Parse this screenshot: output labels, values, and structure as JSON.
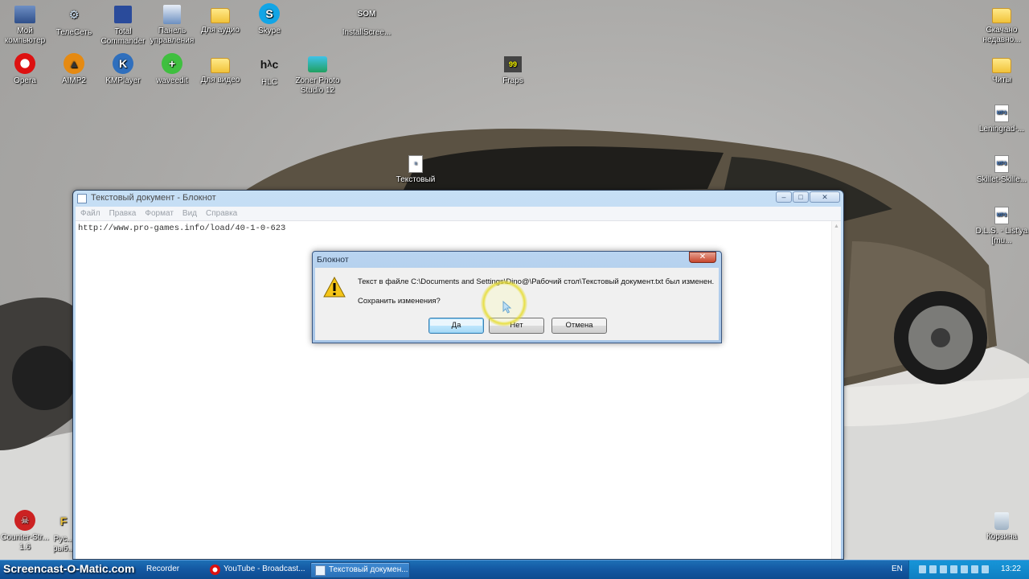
{
  "desktop": {
    "icons": [
      {
        "label": "Мой компьютер",
        "icon": "computer-icon"
      },
      {
        "label": "ТелеСеть",
        "icon": "network-icon"
      },
      {
        "label": "Total Commander",
        "icon": "floppy-icon"
      },
      {
        "label": "Панель управления",
        "icon": "control-panel-icon"
      },
      {
        "label": "Для аудио",
        "icon": "folder-icon"
      },
      {
        "label": "Skype",
        "icon": "skype-icon"
      },
      {
        "label": "InstallScree...",
        "icon": "som-icon"
      },
      {
        "label": "Скачано недавно...",
        "icon": "folder-icon"
      },
      {
        "label": "Opera",
        "icon": "opera-icon"
      },
      {
        "label": "AIMP2",
        "icon": "aimp-icon"
      },
      {
        "label": "KMPlayer",
        "icon": "kmplayer-icon"
      },
      {
        "label": "waveedit",
        "icon": "waveedit-icon"
      },
      {
        "label": "Для видео",
        "icon": "folder-icon"
      },
      {
        "label": "HLC",
        "icon": "hlc-icon"
      },
      {
        "label": "Zoner Photo Studio 12",
        "icon": "zoner-icon"
      },
      {
        "label": "Fraps",
        "icon": "fraps-icon"
      },
      {
        "label": "Читы",
        "icon": "folder-icon"
      },
      {
        "label": "Leningrad-...",
        "icon": "mp3-file-icon"
      },
      {
        "label": "Skillet-Skille...",
        "icon": "mp3-file-icon"
      },
      {
        "label": "D.L.S. - List'ya [mu...",
        "icon": "mp3-file-icon"
      },
      {
        "label": "Текстовый",
        "icon": "text-file-icon"
      },
      {
        "label": "Counter-Str... 1.6",
        "icon": "counter-strike-icon"
      },
      {
        "label": "Рус... рыб...",
        "icon": "game-icon"
      },
      {
        "label": "Корзина",
        "icon": "recycle-bin-icon"
      }
    ]
  },
  "notepad": {
    "title": "Текстовый документ - Блокнот",
    "menu": [
      "Файл",
      "Правка",
      "Формат",
      "Вид",
      "Справка"
    ],
    "content": "http://www.pro-games.info/load/40-1-0-623",
    "controls": {
      "minimize": "–",
      "maximize": "□",
      "close": "✕"
    }
  },
  "dialog": {
    "title": "Блокнот",
    "close": "✕",
    "message": "Текст в файле C:\\Documents and Settings\\Dino@\\Рабочий стол\\Текстовый документ.txt был изменен.",
    "question": "Сохранить изменения?",
    "buttons": {
      "yes": "Да",
      "no": "Нет",
      "cancel": "Отмена"
    }
  },
  "taskbar": {
    "brand": "Screencast-O-Matic.com",
    "items": [
      {
        "label": "Recorder",
        "icon": "recorder-icon"
      },
      {
        "label": "YouTube - Broadcast...",
        "icon": "opera-icon"
      },
      {
        "label": "Текстовый докумен...",
        "icon": "notepad-icon",
        "active": true
      }
    ],
    "lang": "EN",
    "clock": "13:22"
  },
  "colors": {
    "taskbar": "#1459a3",
    "dialog_frame": "#a6c4e6",
    "warning": "#f5c518",
    "cursor_highlight": "#e6dc28"
  }
}
